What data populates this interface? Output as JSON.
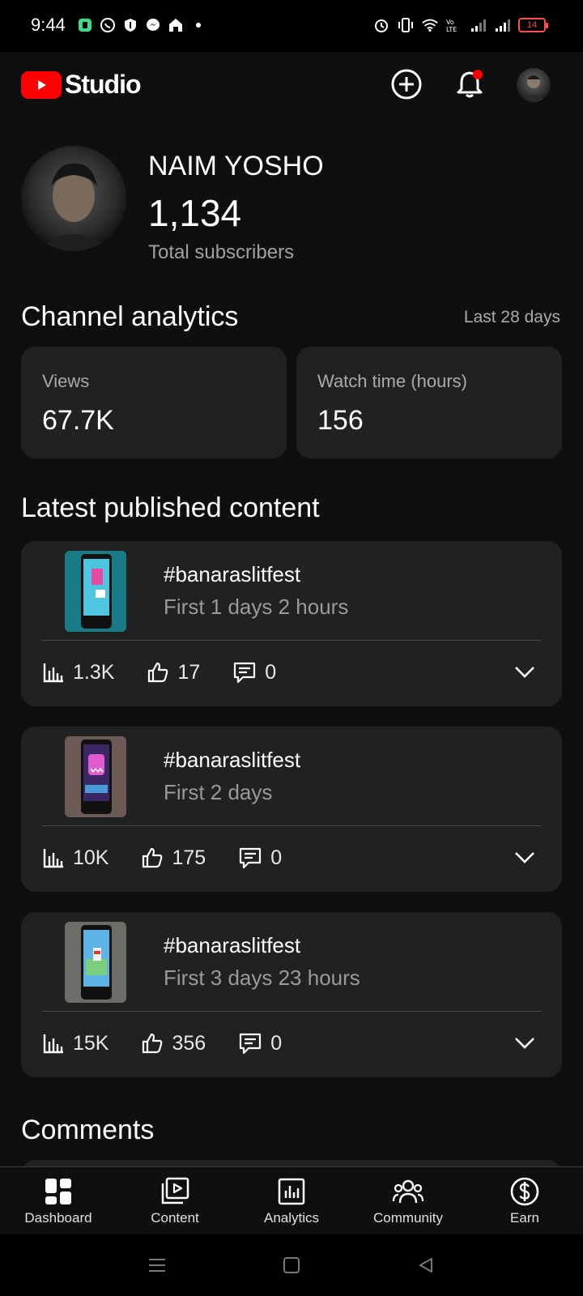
{
  "status_bar": {
    "time": "9:44",
    "battery": "14",
    "left_icons": [
      "sim-icon",
      "whatsapp-icon",
      "shield-icon",
      "messenger-icon",
      "home-app-icon",
      "dot-icon"
    ],
    "right_icons": [
      "alarm-icon",
      "vibrate-icon",
      "wifi-icon",
      "volte-icon",
      "signal-icon",
      "signal-icon",
      "battery-icon"
    ]
  },
  "header": {
    "app_name": "Studio",
    "icons": [
      "youtube-logo-icon",
      "create-icon",
      "notifications-icon",
      "avatar"
    ],
    "notification_badge_color": "#ff0000"
  },
  "channel": {
    "name": "NAIM YOSHO",
    "subscribers": "1,134",
    "subscribers_label": "Total subscribers"
  },
  "analytics": {
    "title": "Channel analytics",
    "period": "Last 28 days",
    "stats": [
      {
        "label": "Views",
        "value": "67.7K"
      },
      {
        "label": "Watch time (hours)",
        "value": "156"
      }
    ]
  },
  "latest": {
    "title": "Latest published content",
    "items": [
      {
        "title": "#banaraslitfest",
        "subtitle": "First 1 days 2 hours",
        "views": "1.3K",
        "likes": "17",
        "comments": "0"
      },
      {
        "title": "#banaraslitfest",
        "subtitle": "First 2 days",
        "views": "10K",
        "likes": "175",
        "comments": "0"
      },
      {
        "title": "#banaraslitfest",
        "subtitle": "First 3 days 23 hours",
        "views": "15K",
        "likes": "356",
        "comments": "0"
      }
    ]
  },
  "comments": {
    "title": "Comments"
  },
  "bottom_nav": [
    {
      "label": "Dashboard",
      "icon": "dashboard-icon"
    },
    {
      "label": "Content",
      "icon": "content-icon"
    },
    {
      "label": "Analytics",
      "icon": "analytics-icon"
    },
    {
      "label": "Community",
      "icon": "community-icon"
    },
    {
      "label": "Earn",
      "icon": "earn-icon"
    }
  ],
  "system_nav": [
    "menu-icon",
    "home-icon",
    "back-icon"
  ],
  "colors": {
    "background": "#0f0f0f",
    "card": "#212121",
    "brand_red": "#ff0000",
    "muted_text": "#aaaaaa"
  }
}
